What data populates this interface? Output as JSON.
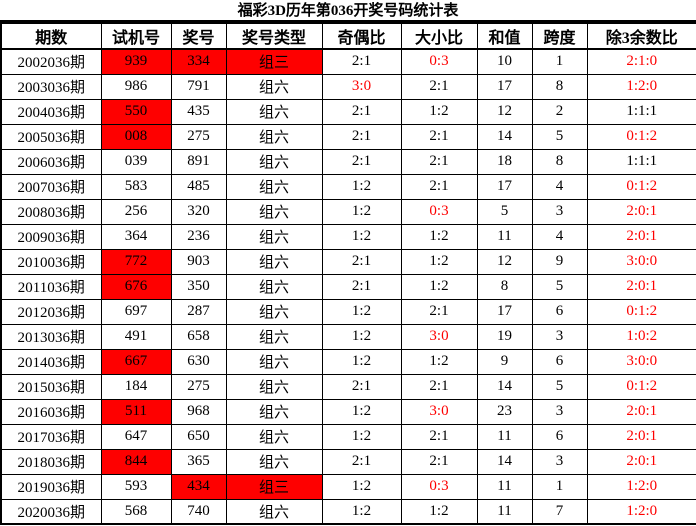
{
  "title": "福彩3D历年第036开奖号码统计表",
  "colors": {
    "highlight_bg": "#fe0000",
    "highlight_text": "#fe0000",
    "normal_text": "#000000",
    "border": "#000000"
  },
  "table": {
    "headers": [
      "期数",
      "试机号",
      "奖号",
      "奖号类型",
      "奇偶比",
      "大小比",
      "和值",
      "跨度",
      "除3余数比"
    ],
    "rows": [
      {
        "period": "2002036期",
        "test_number": "939",
        "test_number_hl": true,
        "prize_number": "334",
        "prize_number_hl": true,
        "type": "组三",
        "type_hl": true,
        "odd_even": "2:1",
        "odd_even_red": false,
        "big_small": "0:3",
        "big_small_red": true,
        "sum": "10",
        "span": "1",
        "mod3": "2:1:0",
        "mod3_red": true
      },
      {
        "period": "2003036期",
        "test_number": "986",
        "test_number_hl": false,
        "prize_number": "791",
        "prize_number_hl": false,
        "type": "组六",
        "type_hl": false,
        "odd_even": "3:0",
        "odd_even_red": true,
        "big_small": "2:1",
        "big_small_red": false,
        "sum": "17",
        "span": "8",
        "mod3": "1:2:0",
        "mod3_red": true
      },
      {
        "period": "2004036期",
        "test_number": "550",
        "test_number_hl": true,
        "prize_number": "435",
        "prize_number_hl": false,
        "type": "组六",
        "type_hl": false,
        "odd_even": "2:1",
        "odd_even_red": false,
        "big_small": "1:2",
        "big_small_red": false,
        "sum": "12",
        "span": "2",
        "mod3": "1:1:1",
        "mod3_red": false
      },
      {
        "period": "2005036期",
        "test_number": "008",
        "test_number_hl": true,
        "prize_number": "275",
        "prize_number_hl": false,
        "type": "组六",
        "type_hl": false,
        "odd_even": "2:1",
        "odd_even_red": false,
        "big_small": "2:1",
        "big_small_red": false,
        "sum": "14",
        "span": "5",
        "mod3": "0:1:2",
        "mod3_red": true
      },
      {
        "period": "2006036期",
        "test_number": "039",
        "test_number_hl": false,
        "prize_number": "891",
        "prize_number_hl": false,
        "type": "组六",
        "type_hl": false,
        "odd_even": "2:1",
        "odd_even_red": false,
        "big_small": "2:1",
        "big_small_red": false,
        "sum": "18",
        "span": "8",
        "mod3": "1:1:1",
        "mod3_red": false
      },
      {
        "period": "2007036期",
        "test_number": "583",
        "test_number_hl": false,
        "prize_number": "485",
        "prize_number_hl": false,
        "type": "组六",
        "type_hl": false,
        "odd_even": "1:2",
        "odd_even_red": false,
        "big_small": "2:1",
        "big_small_red": false,
        "sum": "17",
        "span": "4",
        "mod3": "0:1:2",
        "mod3_red": true
      },
      {
        "period": "2008036期",
        "test_number": "256",
        "test_number_hl": false,
        "prize_number": "320",
        "prize_number_hl": false,
        "type": "组六",
        "type_hl": false,
        "odd_even": "1:2",
        "odd_even_red": false,
        "big_small": "0:3",
        "big_small_red": true,
        "sum": "5",
        "span": "3",
        "mod3": "2:0:1",
        "mod3_red": true
      },
      {
        "period": "2009036期",
        "test_number": "364",
        "test_number_hl": false,
        "prize_number": "236",
        "prize_number_hl": false,
        "type": "组六",
        "type_hl": false,
        "odd_even": "1:2",
        "odd_even_red": false,
        "big_small": "1:2",
        "big_small_red": false,
        "sum": "11",
        "span": "4",
        "mod3": "2:0:1",
        "mod3_red": true
      },
      {
        "period": "2010036期",
        "test_number": "772",
        "test_number_hl": true,
        "prize_number": "903",
        "prize_number_hl": false,
        "type": "组六",
        "type_hl": false,
        "odd_even": "2:1",
        "odd_even_red": false,
        "big_small": "1:2",
        "big_small_red": false,
        "sum": "12",
        "span": "9",
        "mod3": "3:0:0",
        "mod3_red": true
      },
      {
        "period": "2011036期",
        "test_number": "676",
        "test_number_hl": true,
        "prize_number": "350",
        "prize_number_hl": false,
        "type": "组六",
        "type_hl": false,
        "odd_even": "2:1",
        "odd_even_red": false,
        "big_small": "1:2",
        "big_small_red": false,
        "sum": "8",
        "span": "5",
        "mod3": "2:0:1",
        "mod3_red": true
      },
      {
        "period": "2012036期",
        "test_number": "697",
        "test_number_hl": false,
        "prize_number": "287",
        "prize_number_hl": false,
        "type": "组六",
        "type_hl": false,
        "odd_even": "1:2",
        "odd_even_red": false,
        "big_small": "2:1",
        "big_small_red": false,
        "sum": "17",
        "span": "6",
        "mod3": "0:1:2",
        "mod3_red": true
      },
      {
        "period": "2013036期",
        "test_number": "491",
        "test_number_hl": false,
        "prize_number": "658",
        "prize_number_hl": false,
        "type": "组六",
        "type_hl": false,
        "odd_even": "1:2",
        "odd_even_red": false,
        "big_small": "3:0",
        "big_small_red": true,
        "sum": "19",
        "span": "3",
        "mod3": "1:0:2",
        "mod3_red": true
      },
      {
        "period": "2014036期",
        "test_number": "667",
        "test_number_hl": true,
        "prize_number": "630",
        "prize_number_hl": false,
        "type": "组六",
        "type_hl": false,
        "odd_even": "1:2",
        "odd_even_red": false,
        "big_small": "1:2",
        "big_small_red": false,
        "sum": "9",
        "span": "6",
        "mod3": "3:0:0",
        "mod3_red": true
      },
      {
        "period": "2015036期",
        "test_number": "184",
        "test_number_hl": false,
        "prize_number": "275",
        "prize_number_hl": false,
        "type": "组六",
        "type_hl": false,
        "odd_even": "2:1",
        "odd_even_red": false,
        "big_small": "2:1",
        "big_small_red": false,
        "sum": "14",
        "span": "5",
        "mod3": "0:1:2",
        "mod3_red": true
      },
      {
        "period": "2016036期",
        "test_number": "511",
        "test_number_hl": true,
        "prize_number": "968",
        "prize_number_hl": false,
        "type": "组六",
        "type_hl": false,
        "odd_even": "1:2",
        "odd_even_red": false,
        "big_small": "3:0",
        "big_small_red": true,
        "sum": "23",
        "span": "3",
        "mod3": "2:0:1",
        "mod3_red": true
      },
      {
        "period": "2017036期",
        "test_number": "647",
        "test_number_hl": false,
        "prize_number": "650",
        "prize_number_hl": false,
        "type": "组六",
        "type_hl": false,
        "odd_even": "1:2",
        "odd_even_red": false,
        "big_small": "2:1",
        "big_small_red": false,
        "sum": "11",
        "span": "6",
        "mod3": "2:0:1",
        "mod3_red": true
      },
      {
        "period": "2018036期",
        "test_number": "844",
        "test_number_hl": true,
        "prize_number": "365",
        "prize_number_hl": false,
        "type": "组六",
        "type_hl": false,
        "odd_even": "2:1",
        "odd_even_red": false,
        "big_small": "2:1",
        "big_small_red": false,
        "sum": "14",
        "span": "3",
        "mod3": "2:0:1",
        "mod3_red": true
      },
      {
        "period": "2019036期",
        "test_number": "593",
        "test_number_hl": false,
        "prize_number": "434",
        "prize_number_hl": true,
        "type": "组三",
        "type_hl": true,
        "odd_even": "1:2",
        "odd_even_red": false,
        "big_small": "0:3",
        "big_small_red": true,
        "sum": "11",
        "span": "1",
        "mod3": "1:2:0",
        "mod3_red": true
      },
      {
        "period": "2020036期",
        "test_number": "568",
        "test_number_hl": false,
        "prize_number": "740",
        "prize_number_hl": false,
        "type": "组六",
        "type_hl": false,
        "odd_even": "1:2",
        "odd_even_red": false,
        "big_small": "1:2",
        "big_small_red": false,
        "sum": "11",
        "span": "7",
        "mod3": "1:2:0",
        "mod3_red": true
      }
    ]
  }
}
